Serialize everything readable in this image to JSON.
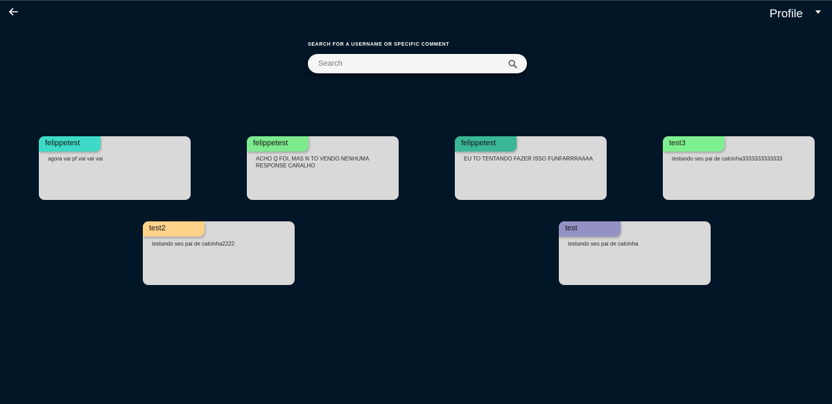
{
  "header": {
    "back_icon": "arrow-left-icon",
    "profile_label": "Profile",
    "profile_caret_icon": "caret-down-icon"
  },
  "search": {
    "label": "SEARCH FOR A USERNAME OR SPECIFIC COMMENT",
    "placeholder": "Search",
    "value": "",
    "icon": "search-icon"
  },
  "comments": [
    {
      "username": "felippetest",
      "text": "agora vai pf vai vai vai",
      "tag_color": "#3ddbc7"
    },
    {
      "username": "felippetest",
      "text": "ACHO Q FOI, MAS N TO VENDO NENHUMA RESPONSE CARALHO",
      "tag_color": "#7eea8e"
    },
    {
      "username": "felippetest",
      "text": "EU TO TENTANDO FAZER ISSO FUNFARRRAAAA",
      "tag_color": "#3ab795"
    },
    {
      "username": "test3",
      "text": "testando seu pai de calcinha3333333333333",
      "tag_color": "#7ff08f"
    },
    {
      "username": "test2",
      "text": "testando seu pai de calcinha2222",
      "tag_color": "#fdd289"
    },
    {
      "username": "test",
      "text": "testando seu pai de calcinha",
      "tag_color": "#9491c5"
    }
  ],
  "colors": {
    "background": "#011627",
    "card": "#d9d9d9"
  }
}
